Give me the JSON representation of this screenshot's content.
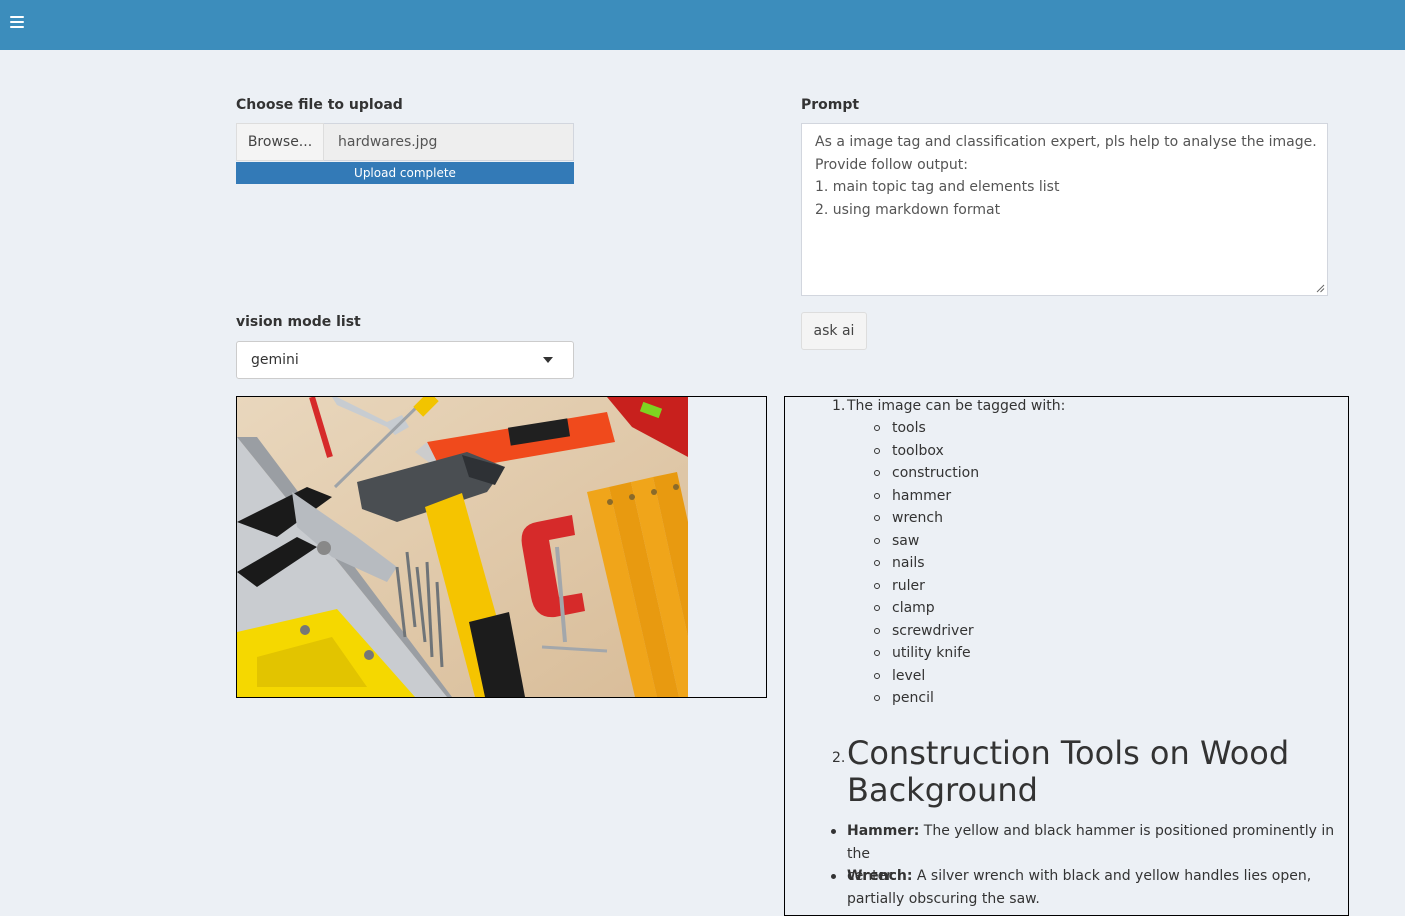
{
  "header": {
    "menu_icon": "hamburger-icon",
    "color": "#3c8dbc"
  },
  "upload": {
    "label": "Choose file to upload",
    "browse_label": "Browse...",
    "file_name": "hardwares.jpg",
    "progress_text": "Upload complete",
    "progress_percent": 100
  },
  "model": {
    "label": "vision mode list",
    "selected": "gemini"
  },
  "prompt": {
    "label": "Prompt",
    "lines": [
      "As a image tag and classification expert, pls help to analyse the image.",
      "Provide follow output:",
      "1. main topic tag and elements list",
      "2. using markdown format"
    ]
  },
  "ask_button": "ask ai",
  "image": {
    "tools": [
      "hacksaw",
      "pliers",
      "wrench",
      "screwdriver",
      "pencil",
      "utility knife",
      "level",
      "hammer",
      "nails",
      "clamp",
      "folding ruler"
    ]
  },
  "result": {
    "item1_num": "1.",
    "item1_text": "The image can be tagged with:",
    "tags": [
      "tools",
      "toolbox",
      "construction",
      "hammer",
      "wrench",
      "saw",
      "nails",
      "ruler",
      "clamp",
      "screwdriver",
      "utility knife",
      "level",
      "pencil"
    ],
    "item2_num": "2.",
    "heading_line1": "Construction Tools on Wood",
    "heading_line2": "Background",
    "details": [
      {
        "term": "Hammer:",
        "line1": "The yellow and black hammer is positioned prominently in the",
        "line2": "center."
      },
      {
        "term": "Wrench:",
        "line1": "A silver wrench with black and yellow handles lies open,",
        "line2": "partially obscuring the saw."
      }
    ]
  }
}
